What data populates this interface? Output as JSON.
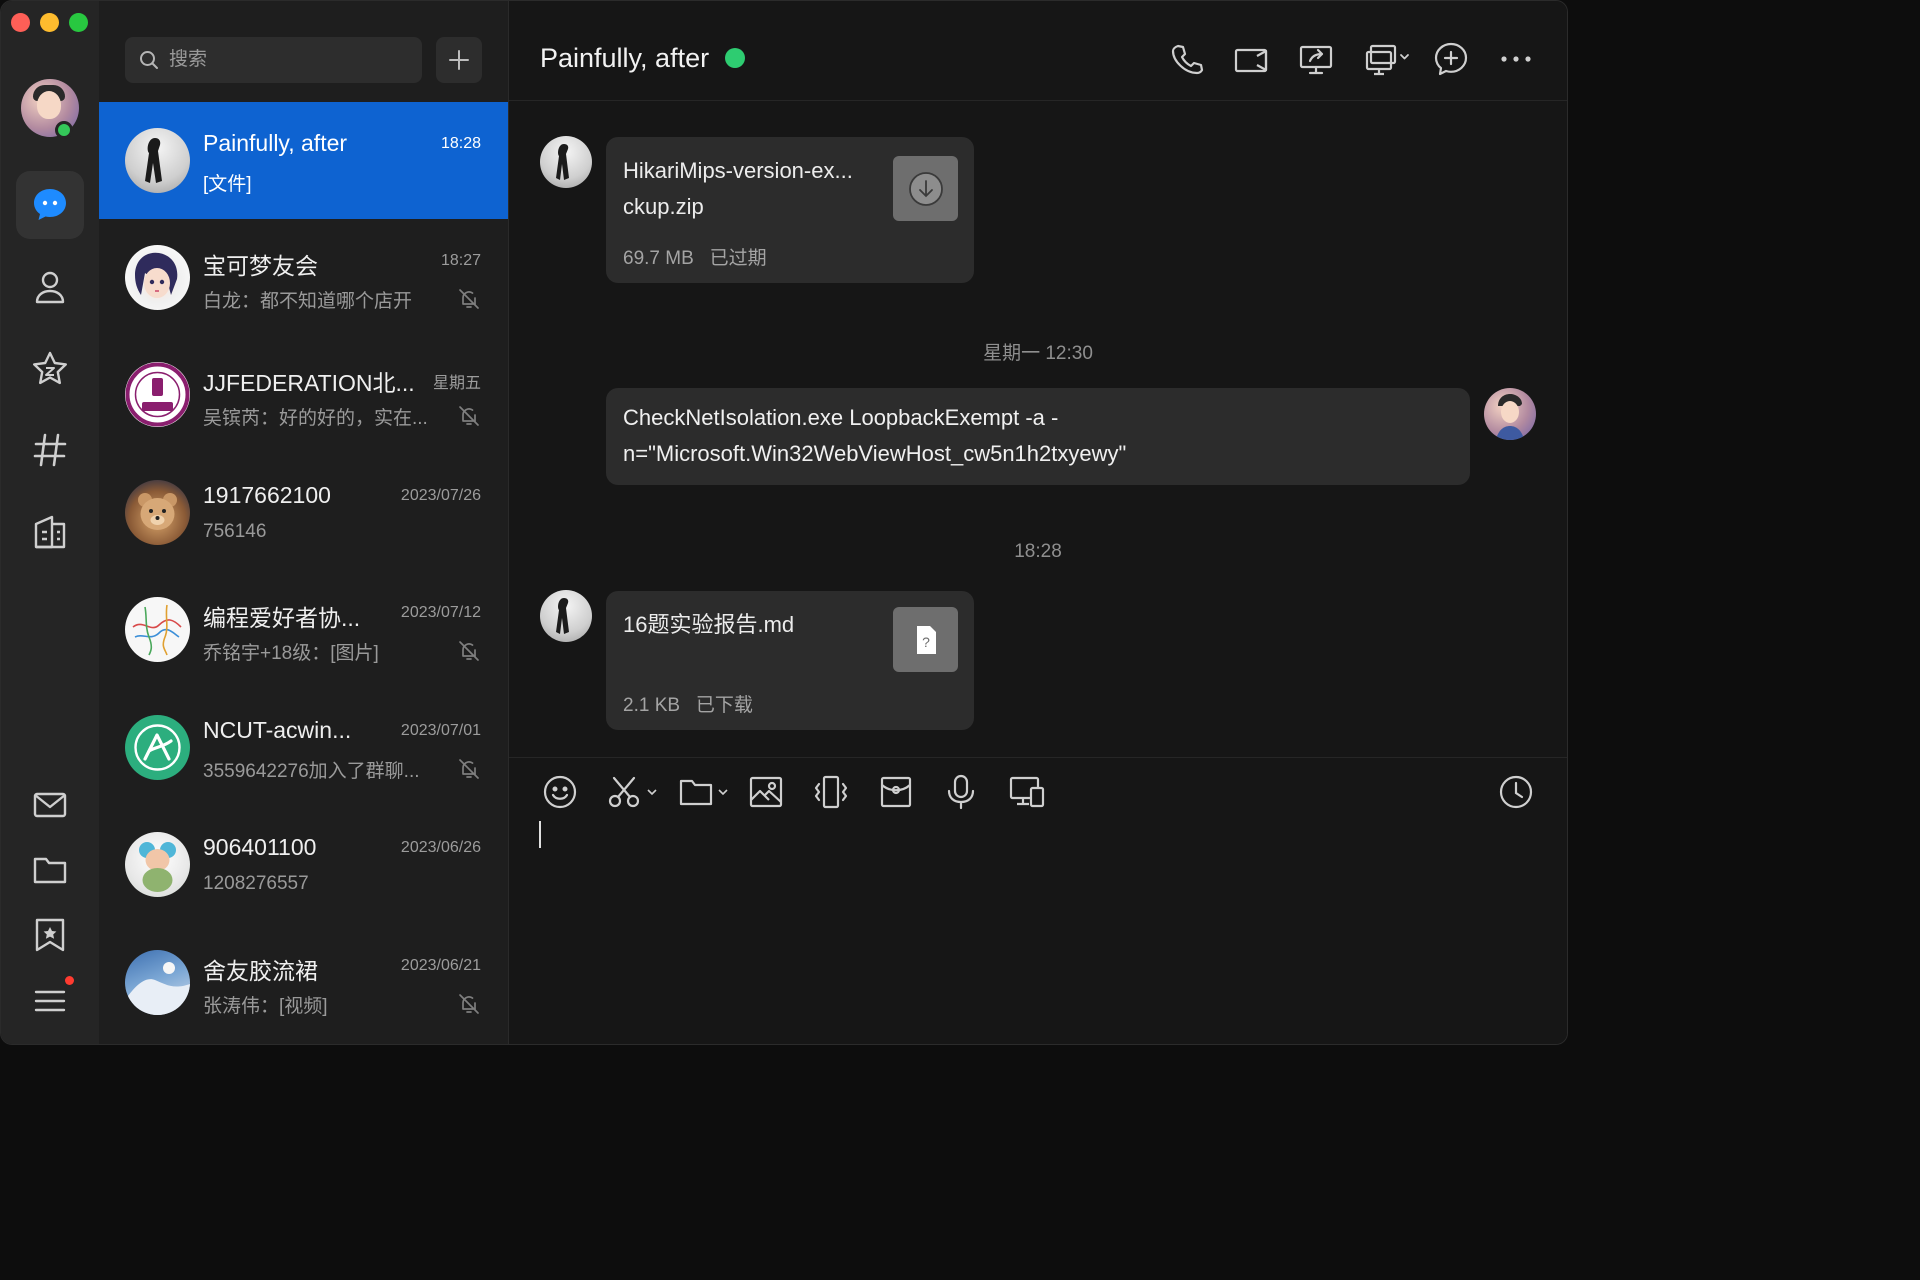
{
  "colors": {
    "accent": "#0e63d1",
    "online": "#2ecc71",
    "badge": "#ff3b30",
    "rail_bg": "#252525",
    "list_bg": "#1e1e1e",
    "chat_bg": "#161616",
    "bubble_bg": "#2c2c2c"
  },
  "rail": {
    "items": [
      {
        "icon": "chat-bubble-icon",
        "active": true
      },
      {
        "icon": "contacts-icon",
        "active": false
      },
      {
        "icon": "zone-star-icon",
        "active": false
      },
      {
        "icon": "channel-hash-icon",
        "active": false
      },
      {
        "icon": "mini-apps-icon",
        "active": false
      },
      {
        "icon": "mail-icon",
        "active": false
      },
      {
        "icon": "folder-icon",
        "active": false
      },
      {
        "icon": "favorites-bookmark-icon",
        "active": false
      },
      {
        "icon": "menu-icon",
        "active": false,
        "badge": true
      }
    ]
  },
  "search": {
    "placeholder": "搜索",
    "value": ""
  },
  "conversations": [
    {
      "name": "Painfully, after",
      "time": "18:28",
      "preview": "[文件]",
      "muted": false,
      "selected": true
    },
    {
      "name": "宝可梦友会",
      "time": "18:27",
      "preview": "白龙：都不知道哪个店开",
      "muted": true,
      "selected": false
    },
    {
      "name": "JJFEDERATION北...",
      "time": "星期五",
      "preview": "吴镔芮：好的好的，实在...",
      "muted": true,
      "selected": false
    },
    {
      "name": "1917662100",
      "time": "2023/07/26",
      "preview": "756146",
      "muted": false,
      "selected": false
    },
    {
      "name": "编程爱好者协...",
      "time": "2023/07/12",
      "preview": "乔铭宇+18级：[图片]",
      "muted": true,
      "selected": false
    },
    {
      "name": "NCUT-acwin...",
      "time": "2023/07/01",
      "preview": "3559642276加入了群聊...",
      "muted": true,
      "selected": false
    },
    {
      "name": "906401100",
      "time": "2023/06/26",
      "preview": "1208276557",
      "muted": false,
      "selected": false
    },
    {
      "name": "舍友胶流裙",
      "time": "2023/06/21",
      "preview": "张涛伟：[视频]",
      "muted": true,
      "selected": false
    }
  ],
  "chat": {
    "title": "Painfully, after",
    "header_icons": [
      "phone-icon",
      "video-call-icon",
      "screen-share-icon",
      "remote-desktop-icon",
      "add-member-icon",
      "more-icon"
    ],
    "messages": [
      {
        "type": "file",
        "from": "them",
        "file_name_line1": "HikariMips-version-ex...",
        "file_name_line2": "ckup.zip",
        "size": "69.7 MB",
        "status": "已过期",
        "thumb_icon": "download-icon"
      },
      {
        "type": "timestamp",
        "text": "星期一 12:30"
      },
      {
        "type": "text",
        "from": "me",
        "line1": "CheckNetIsolation.exe LoopbackExempt -a -",
        "line2": "n=\"Microsoft.Win32WebViewHost_cw5n1h2txyewy\""
      },
      {
        "type": "timestamp",
        "text": "18:28"
      },
      {
        "type": "file",
        "from": "them",
        "file_name_line1": "16题实验报告.md",
        "size": "2.1 KB",
        "status": "已下载",
        "thumb_icon": "unknown-file-icon",
        "thumb_text": "?"
      }
    ]
  },
  "composer": {
    "tools": [
      "emoji-icon",
      "screenshot-scissors-icon",
      "folder-icon",
      "image-icon",
      "shake-icon",
      "red-packet-icon",
      "microphone-icon",
      "screen-devices-icon"
    ],
    "history_icon": "history-clock-icon",
    "value": ""
  }
}
